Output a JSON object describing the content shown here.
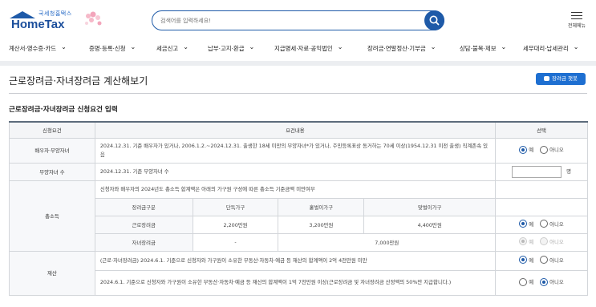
{
  "header": {
    "logo_kr": "국세청홈택스",
    "logo_en": "HomeTax",
    "search_placeholder": "검색어를 입력하세요!",
    "menu_all_label": "전체메뉴"
  },
  "nav": {
    "items": [
      "계산서·영수증·카드",
      "증명·등록·신청",
      "세금신고",
      "납부·고지·환급",
      "지급명세·자료·공익법인",
      "장려금·연말정산·기부금",
      "상담·불복·제보",
      "세무대리·납세관리"
    ]
  },
  "page": {
    "title": "근로장려금·자녀장려금 계산해보기",
    "chatbot_label": "장려금 챗봇",
    "section_title": "근로장려금·자녀장려금 신청요건 입력"
  },
  "table": {
    "headers": [
      "신청요건",
      "요건내용",
      "선택"
    ],
    "rows": {
      "spouse_label": "배우자·부양자녀",
      "spouse_text": "2024.12.31. 기준 배우자가 있거나, 2006.1.2.~2024.12.31. 출생한 18세 미만의 부양자녀*가 있거나, 주민등록표상 동거하는 70세 이상(1954.12.31 이전 출생) 직계존속 있음",
      "children_label": "부양자녀 수",
      "children_text": "2024.12.31. 기준 부양자녀 수",
      "children_unit": "명",
      "income_label": "총소득",
      "income_text": "신청자와 배우자의 2024년도 총소득 합계액은 아래의 가구원 구성에 따른 총소득 기준금액 미만여부",
      "income_sub_headers": [
        "장려금구분",
        "단독가구",
        "홑벌이가구",
        "맞벌이가구"
      ],
      "income_earned": [
        "근로장려금",
        "2,200만원",
        "3,200만원",
        "4,400만원"
      ],
      "income_child": [
        "자녀장려금",
        "-",
        "7,000만원"
      ],
      "asset_label": "재산",
      "asset_text1": "(근로·자녀장려금) 2024.6.1. 기준으로 신청자와 가구원이 소유한 부동산·자동차·예금 등 재산의 합계액이 2억 4천만원 미만",
      "asset_text2": "2024.6.1. 기준으로 신청자와 가구원이 소유한 부동산·자동차·예금 등 재산의 합계액이 1억 7천만원 이상(근로장려금 및 자녀장려금 산정액의 50%만 지급합니다.)"
    },
    "yes": "예",
    "no": "아니오"
  }
}
